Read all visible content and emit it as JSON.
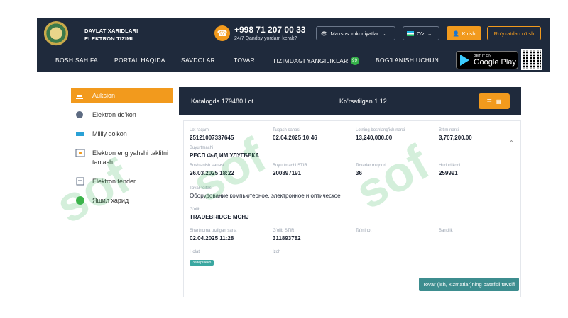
{
  "header": {
    "brand_line1": "DAVLAT XARIDLARI",
    "brand_line2": "ELEKTRON TIZIMI",
    "phone": "+998 71 207 00 33",
    "phone_sub": "24/7 Qanday yordam kerak?",
    "accessibility": "Maxsus imkoniyatlar",
    "language": "O'z",
    "login": "Kirish",
    "register": "Ro'yxatdan o'tish"
  },
  "nav": {
    "items": [
      "BOSH SAHIFA",
      "PORTAL HAQIDA",
      "SAVDOLAR",
      "TOVAR",
      "TIZIMDAGI YANGILIKLAR",
      "BOG'LANISH UCHUN"
    ],
    "badge": "99"
  },
  "gplay": {
    "small": "GET IT ON",
    "big": "Google Play"
  },
  "sidebar": {
    "items": [
      {
        "label": "Auksion",
        "active": true
      },
      {
        "label": "Elektron do'kon"
      },
      {
        "label": "Milliy do'kon"
      },
      {
        "label": "Elektron eng yahshi taklifni tanlash"
      },
      {
        "label": "Elektron tender"
      },
      {
        "label": "Яшил харид"
      }
    ]
  },
  "catalog": {
    "count_text": "Katalogda 179480 Lot",
    "shown_text": "Ko'rsatilgan 1 12"
  },
  "lot": {
    "lot_number": "25121007337645",
    "date_end": "02.04.2025 10:46",
    "start_price": "13,240,000.00",
    "price_2": "3,707,200.00",
    "customer": "РЕСП Ф-Д ИМ.УЛУГБЕКА",
    "date_start": "26.03.2025 18:22",
    "inn": "200897191",
    "quantity": "36",
    "region_code": "259991",
    "category": "Оборудование компьютерное, электронное и оптическое",
    "seller": "TRADEBRIDGE MCHJ",
    "date_contract": "02.04.2025 11:28",
    "seller_inn": "311893782",
    "status": "Завершено",
    "action": "Tovar (ish, xizmatlar)ning batafsil tavsifi"
  },
  "watermark": "sof"
}
